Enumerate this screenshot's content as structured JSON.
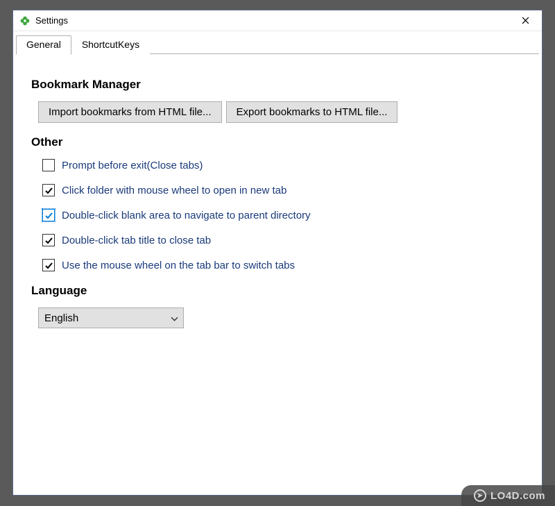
{
  "window": {
    "title": "Settings"
  },
  "tabs": [
    {
      "label": "General",
      "active": true
    },
    {
      "label": "ShortcutKeys",
      "active": false
    }
  ],
  "sections": {
    "bookmark": {
      "heading": "Bookmark Manager",
      "import_btn": "Import bookmarks from HTML file...",
      "export_btn": "Export bookmarks to HTML file..."
    },
    "other": {
      "heading": "Other",
      "options": [
        {
          "label": "Prompt before exit(Close tabs)",
          "checked": false,
          "focused": false
        },
        {
          "label": "Click folder with mouse wheel to open in new tab",
          "checked": true,
          "focused": false
        },
        {
          "label": "Double-click blank area to navigate to parent directory",
          "checked": true,
          "focused": true
        },
        {
          "label": "Double-click tab title to close tab",
          "checked": true,
          "focused": false
        },
        {
          "label": "Use the mouse wheel on the tab bar to switch tabs",
          "checked": true,
          "focused": false
        }
      ]
    },
    "language": {
      "heading": "Language",
      "selected": "English"
    }
  },
  "watermark": {
    "text": "LO4D.com"
  }
}
